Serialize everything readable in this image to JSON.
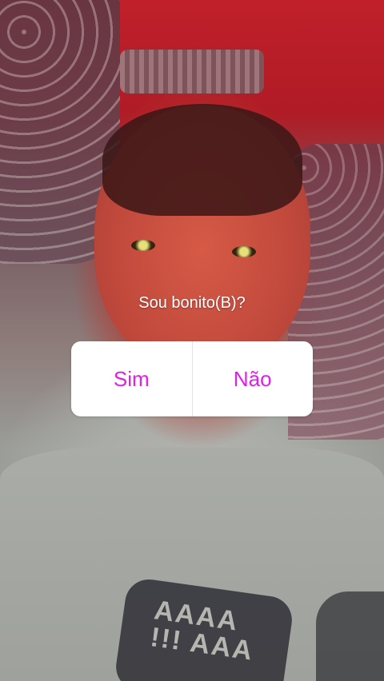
{
  "poll": {
    "question": "Sou bonito(B)?",
    "option_yes": "Sim",
    "option_no": "Não",
    "option_color": "#e01fe8"
  },
  "photo": {
    "shirt_print_line1": "AAAA",
    "shirt_print_line2": "!!! AAA"
  }
}
